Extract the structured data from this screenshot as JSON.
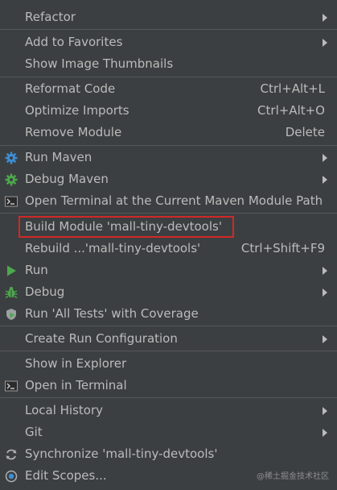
{
  "items": [
    {
      "label": "Refactor",
      "has_submenu": true
    },
    {
      "label": "Add to Favorites",
      "has_submenu": true
    },
    {
      "label": "Show Image Thumbnails"
    },
    {
      "label": "Reformat Code",
      "shortcut": "Ctrl+Alt+L"
    },
    {
      "label": "Optimize Imports",
      "shortcut": "Ctrl+Alt+O"
    },
    {
      "label": "Remove Module",
      "shortcut": "Delete"
    },
    {
      "label": "Run Maven",
      "icon": "gear-icon",
      "has_submenu": true
    },
    {
      "label": "Debug Maven",
      "icon": "gear-bug-icon",
      "has_submenu": true
    },
    {
      "label": "Open Terminal at the Current Maven Module Path",
      "icon": "terminal-icon"
    },
    {
      "label": "Build Module 'mall-tiny-devtools'",
      "highlighted": true
    },
    {
      "label": "Rebuild ...'mall-tiny-devtools'",
      "shortcut": "Ctrl+Shift+F9"
    },
    {
      "label": "Run",
      "icon": "play-icon",
      "has_submenu": true
    },
    {
      "label": "Debug",
      "icon": "bug-icon",
      "has_submenu": true
    },
    {
      "label": "Run 'All Tests' with Coverage",
      "icon": "coverage-icon"
    },
    {
      "label": "Create Run Configuration",
      "has_submenu": true
    },
    {
      "label": "Show in Explorer"
    },
    {
      "label": "Open in Terminal",
      "icon": "terminal-icon"
    },
    {
      "label": "Local History",
      "has_submenu": true
    },
    {
      "label": "Git",
      "has_submenu": true
    },
    {
      "label": "Synchronize 'mall-tiny-devtools'",
      "icon": "sync-icon"
    },
    {
      "label": "Edit Scopes...",
      "icon": "scope-icon"
    }
  ],
  "watermark": "@稀土掘金技术社区",
  "colors": {
    "background": "#3c3f41",
    "text": "#bbbbbb",
    "separator": "#555759",
    "highlight_border": "#d22828"
  }
}
